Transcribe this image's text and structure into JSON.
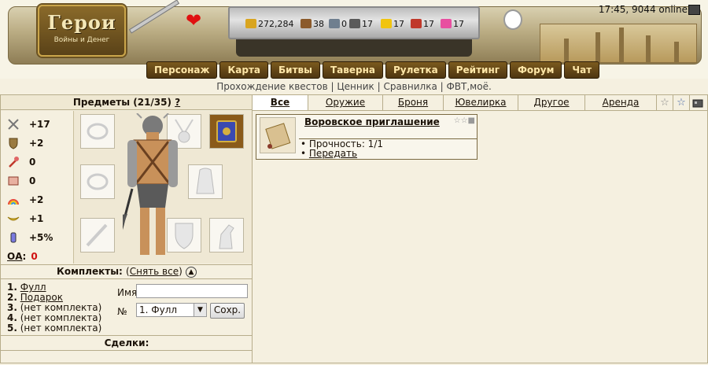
{
  "header": {
    "logo": {
      "title": "Герои",
      "subtitle": "Войны и Денег"
    },
    "resources": [
      {
        "name": "gold",
        "value": "272,284",
        "color": "#d9a520"
      },
      {
        "name": "wood",
        "value": "38",
        "color": "#8b5a2b"
      },
      {
        "name": "ore",
        "value": "0",
        "color": "#6f7f8f"
      },
      {
        "name": "mercury",
        "value": "17",
        "color": "#5a5a5a"
      },
      {
        "name": "sulfur",
        "value": "17",
        "color": "#f1c40f"
      },
      {
        "name": "crystal",
        "value": "17",
        "color": "#c0392b"
      },
      {
        "name": "gems",
        "value": "17",
        "color": "#e84fa0"
      }
    ],
    "status_time": "17:45, 9044 online",
    "nav": [
      "Персонаж",
      "Карта",
      "Битвы",
      "Таверна",
      "Рулетка",
      "Рейтинг",
      "Форум",
      "Чат"
    ],
    "links": [
      "Прохождение квестов",
      "Ценник",
      "Сравнилка",
      "ФВТ,моё."
    ]
  },
  "items_panel": {
    "title": "Предметы (21/35)",
    "help": "?",
    "stats": [
      {
        "icon": "attack-icon",
        "value": "+17"
      },
      {
        "icon": "defense-icon",
        "value": "+2"
      },
      {
        "icon": "spell-power-icon",
        "value": "0"
      },
      {
        "icon": "knowledge-icon",
        "value": "0"
      },
      {
        "icon": "luck-icon",
        "value": "+2"
      },
      {
        "icon": "morale-icon",
        "value": "+1"
      },
      {
        "icon": "initiative-icon",
        "value": "+5%"
      }
    ],
    "oa": {
      "label": "ОА",
      "value": "0"
    }
  },
  "sets": {
    "title": "Комплекты:",
    "unset_all": "Снять все",
    "list": [
      {
        "num": "1.",
        "label": "Фулл",
        "link": true
      },
      {
        "num": "2.",
        "label": "Подарок",
        "link": true
      },
      {
        "num": "3.",
        "label": "(нет комплекта)",
        "link": false
      },
      {
        "num": "4.",
        "label": "(нет комплекта)",
        "link": false
      },
      {
        "num": "5.",
        "label": "(нет комплекта)",
        "link": false
      }
    ],
    "name_label": "Имя",
    "name_value": "",
    "num_label": "№",
    "num_selected": "1. Фулл",
    "save": "Сохр."
  },
  "deals": {
    "title": "Сделки:"
  },
  "inventory": {
    "tabs": [
      "Все",
      "Оружие",
      "Броня",
      "Ювелирка",
      "Другое",
      "Аренда"
    ],
    "active_tab": "Все",
    "item": {
      "name": "Воровское приглашение",
      "durability_label": "Прочность: 1/1",
      "transfer": "Передать"
    }
  }
}
